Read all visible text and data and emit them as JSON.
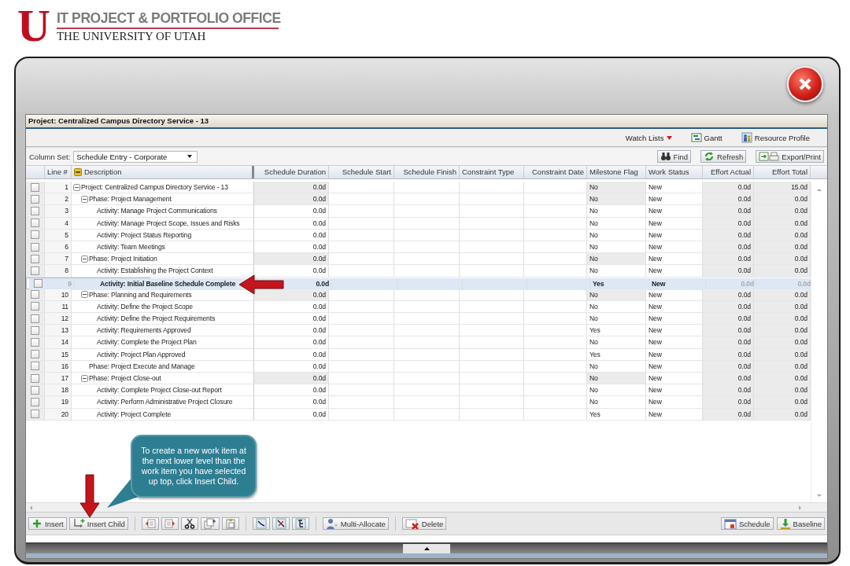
{
  "header": {
    "logo": "U",
    "title": "IT PROJECT & PORTFOLIO OFFICE",
    "subtitle": "THE UNIVERSITY OF UTAH"
  },
  "window": {
    "title": "Project: Centralized Campus Directory Service - 13"
  },
  "toolbar": [
    {
      "kind": "menu",
      "label": "Watch Lists"
    },
    {
      "kind": "gantt",
      "label": "Gantt"
    },
    {
      "kind": "resource",
      "label": "Resource Profile"
    }
  ],
  "column_set": {
    "label": "Column Set:",
    "value": "Schedule Entry - Corporate"
  },
  "actions": [
    {
      "kind": "find",
      "label": "Find"
    },
    {
      "kind": "refresh",
      "label": "Refresh"
    },
    {
      "kind": "export",
      "label": "Export/Print"
    }
  ],
  "table": {
    "columns": [
      "Line #",
      "Description",
      "Schedule Duration",
      "Schedule Start",
      "Schedule Finish",
      "Constraint Type",
      "Constraint Date",
      "Milestone Flag",
      "Work Status",
      "Effort Actual",
      "Effort Total"
    ],
    "rows": [
      {
        "line": "1",
        "description": "Project: Centralized Campus Directory Service - 13",
        "checked": false,
        "selected": false,
        "expanded": true,
        "duration": "0.0d",
        "milestone": "No",
        "work_status": "New",
        "effort_actual": "0.0d",
        "effort_total": "15.0d",
        "children": [
          {
            "line": "2",
            "description": "Phase: Project Management",
            "checked": false,
            "selected": false,
            "expanded": true,
            "duration": "0.0d",
            "milestone": "No",
            "work_status": "New",
            "effort_actual": "0.0d",
            "effort_total": "0.0d",
            "children": [
              {
                "line": "3",
                "description": "Activity: Manage Project Communications",
                "checked": false,
                "selected": false,
                "duration": "0.0d",
                "milestone": "No",
                "work_status": "New",
                "effort_actual": "0.0d",
                "effort_total": "0.0d"
              },
              {
                "line": "4",
                "description": "Activity: Manage Project Scope, Issues and Risks",
                "checked": false,
                "selected": false,
                "duration": "0.0d",
                "milestone": "No",
                "work_status": "New",
                "effort_actual": "0.0d",
                "effort_total": "0.0d"
              },
              {
                "line": "5",
                "description": "Activity: Project Status Reporting",
                "checked": false,
                "selected": false,
                "duration": "0.0d",
                "milestone": "No",
                "work_status": "New",
                "effort_actual": "0.0d",
                "effort_total": "0.0d"
              },
              {
                "line": "6",
                "description": "Activity: Team Meetings",
                "checked": false,
                "selected": false,
                "duration": "0.0d",
                "milestone": "No",
                "work_status": "New",
                "effort_actual": "0.0d",
                "effort_total": "0.0d"
              }
            ]
          },
          {
            "line": "7",
            "description": "Phase: Project Initiation",
            "checked": false,
            "selected": false,
            "expanded": true,
            "duration": "0.0d",
            "milestone": "No",
            "work_status": "New",
            "effort_actual": "0.0d",
            "effort_total": "0.0d",
            "children": [
              {
                "line": "8",
                "description": "Activity: Establishing the Project Context",
                "checked": false,
                "selected": false,
                "duration": "0.0d",
                "milestone": "No",
                "work_status": "New",
                "effort_actual": "0.0d",
                "effort_total": "0.0d"
              },
              {
                "line": "9",
                "description": "Activity: Initial Baseline Schedule Complete",
                "checked": false,
                "selected": true,
                "duration": "0.0d",
                "milestone": "Yes",
                "work_status": "New",
                "effort_actual": "0.0d",
                "effort_total": "0.0d"
              }
            ]
          },
          {
            "line": "10",
            "description": "Phase: Planning and Requirements",
            "checked": false,
            "selected": false,
            "expanded": true,
            "duration": "0.0d",
            "milestone": "No",
            "work_status": "New",
            "effort_actual": "0.0d",
            "effort_total": "0.0d",
            "children": [
              {
                "line": "11",
                "description": "Activity: Define the Project Scope",
                "checked": false,
                "selected": false,
                "duration": "0.0d",
                "milestone": "No",
                "work_status": "New",
                "effort_actual": "0.0d",
                "effort_total": "0.0d"
              },
              {
                "line": "12",
                "description": "Activity: Define the Project Requirements",
                "checked": false,
                "selected": false,
                "duration": "0.0d",
                "milestone": "No",
                "work_status": "New",
                "effort_actual": "0.0d",
                "effort_total": "0.0d"
              },
              {
                "line": "13",
                "description": "Activity: Requirements Approved",
                "checked": false,
                "selected": false,
                "duration": "0.0d",
                "milestone": "Yes",
                "work_status": "New",
                "effort_actual": "0.0d",
                "effort_total": "0.0d"
              },
              {
                "line": "14",
                "description": "Activity: Complete the Project Plan",
                "checked": false,
                "selected": false,
                "duration": "0.0d",
                "milestone": "No",
                "work_status": "New",
                "effort_actual": "0.0d",
                "effort_total": "0.0d"
              },
              {
                "line": "15",
                "description": "Activity: Project Plan Approved",
                "checked": false,
                "selected": false,
                "duration": "0.0d",
                "milestone": "Yes",
                "work_status": "New",
                "effort_actual": "0.0d",
                "effort_total": "0.0d"
              }
            ]
          },
          {
            "line": "16",
            "description": "Phase: Project Execute and Manage",
            "checked": false,
            "selected": false,
            "duration": "0.0d",
            "milestone": "No",
            "work_status": "New",
            "effort_actual": "0.0d",
            "effort_total": "0.0d"
          },
          {
            "line": "17",
            "description": "Phase: Project Close-out",
            "checked": false,
            "selected": false,
            "expanded": true,
            "duration": "0.0d",
            "milestone": "No",
            "work_status": "New",
            "effort_actual": "0.0d",
            "effort_total": "0.0d",
            "children": [
              {
                "line": "18",
                "description": "Activity: Complete Project Close-out Report",
                "checked": false,
                "selected": false,
                "duration": "0.0d",
                "milestone": "No",
                "work_status": "New",
                "effort_actual": "0.0d",
                "effort_total": "0.0d"
              },
              {
                "line": "19",
                "description": "Activity: Perform Administrative Project Closure",
                "checked": false,
                "selected": false,
                "duration": "0.0d",
                "milestone": "No",
                "work_status": "New",
                "effort_actual": "0.0d",
                "effort_total": "0.0d"
              },
              {
                "line": "20",
                "description": "Activity: Project Complete",
                "checked": false,
                "selected": false,
                "duration": "0.0d",
                "milestone": "Yes",
                "work_status": "New",
                "effort_actual": "0.0d",
                "effort_total": "0.0d"
              }
            ]
          }
        ]
      }
    ]
  },
  "bottom_toolbar": {
    "groups": [
      [
        {
          "kind": "insert",
          "label": "Insert"
        },
        {
          "kind": "insert-child",
          "label": "Insert Child"
        }
      ],
      [
        {
          "kind": "outdent"
        },
        {
          "kind": "indent"
        },
        {
          "kind": "cut"
        },
        {
          "kind": "copy"
        },
        {
          "kind": "paste"
        }
      ],
      [
        {
          "kind": "link"
        },
        {
          "kind": "unlink"
        },
        {
          "kind": "wbs"
        }
      ],
      [
        {
          "kind": "multi-allocate",
          "label": "Multi-Allocate"
        }
      ],
      [
        {
          "kind": "delete",
          "label": "Delete"
        }
      ]
    ],
    "right": [
      {
        "kind": "schedule",
        "label": "Schedule"
      },
      {
        "kind": "baseline",
        "label": "Baseline"
      }
    ]
  },
  "callout": {
    "text": "To create a new work item at the next lower level than the work item you have selected up top, click Insert Child."
  }
}
